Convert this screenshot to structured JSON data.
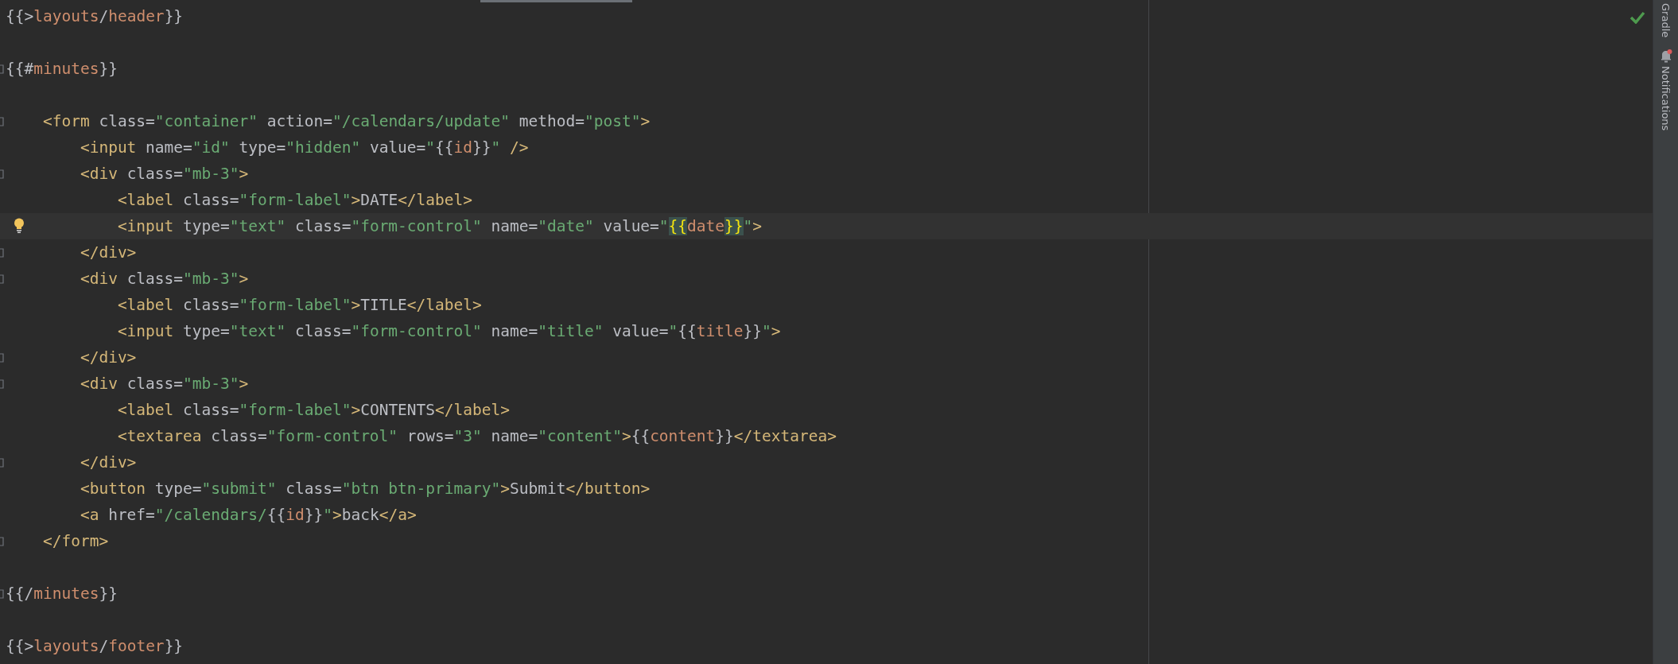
{
  "editor": {
    "lines": [
      {
        "current": false,
        "foldable": false,
        "lightbulb": false,
        "tokens": [
          {
            "kind": "punct",
            "text": "{{>"
          },
          {
            "kind": "var",
            "text": "layouts"
          },
          {
            "kind": "punct",
            "text": "/"
          },
          {
            "kind": "var",
            "text": "header"
          },
          {
            "kind": "punct",
            "text": "}}"
          }
        ]
      },
      {
        "current": false,
        "foldable": false,
        "lightbulb": false
      },
      {
        "current": false,
        "foldable": true,
        "lightbulb": false,
        "tokens": [
          {
            "kind": "punct",
            "text": "{{#"
          },
          {
            "kind": "var",
            "text": "minutes"
          },
          {
            "kind": "punct",
            "text": "}}"
          }
        ]
      },
      {
        "current": false,
        "foldable": false,
        "lightbulb": false
      },
      {
        "current": false,
        "foldable": true,
        "lightbulb": false,
        "tokens": [
          {
            "kind": "tag",
            "text": "    <form "
          },
          {
            "kind": "attr",
            "text": "class="
          },
          {
            "kind": "str",
            "text": "\"container\" "
          },
          {
            "kind": "attr",
            "text": "action="
          },
          {
            "kind": "str",
            "text": "\"/calendars/update\" "
          },
          {
            "kind": "attr",
            "text": "method="
          },
          {
            "kind": "str",
            "text": "\"post\""
          },
          {
            "kind": "tag",
            "text": ">"
          }
        ]
      },
      {
        "current": false,
        "foldable": false,
        "lightbulb": false,
        "tokens": [
          {
            "kind": "tag",
            "text": "        <input "
          },
          {
            "kind": "attr",
            "text": "name="
          },
          {
            "kind": "str",
            "text": "\"id\" "
          },
          {
            "kind": "attr",
            "text": "type="
          },
          {
            "kind": "str",
            "text": "\"hidden\" "
          },
          {
            "kind": "attr",
            "text": "value="
          },
          {
            "kind": "str",
            "text": "\""
          },
          {
            "kind": "punct",
            "text": "{{"
          },
          {
            "kind": "var",
            "text": "id"
          },
          {
            "kind": "punct",
            "text": "}}"
          },
          {
            "kind": "str",
            "text": "\" "
          },
          {
            "kind": "tag",
            "text": "/>"
          }
        ]
      },
      {
        "current": false,
        "foldable": true,
        "lightbulb": false,
        "tokens": [
          {
            "kind": "tag",
            "text": "        <div "
          },
          {
            "kind": "attr",
            "text": "class="
          },
          {
            "kind": "str",
            "text": "\"mb-3\""
          },
          {
            "kind": "tag",
            "text": ">"
          }
        ]
      },
      {
        "current": false,
        "foldable": false,
        "lightbulb": false,
        "tokens": [
          {
            "kind": "tag",
            "text": "            <label "
          },
          {
            "kind": "attr",
            "text": "class="
          },
          {
            "kind": "str",
            "text": "\"form-label\""
          },
          {
            "kind": "tag",
            "text": ">"
          },
          {
            "kind": "text",
            "text": "DATE"
          },
          {
            "kind": "tag",
            "text": "</label>"
          }
        ]
      },
      {
        "current": true,
        "foldable": false,
        "lightbulb": true,
        "tokens": [
          {
            "kind": "tag",
            "text": "            <input "
          },
          {
            "kind": "attr",
            "text": "type="
          },
          {
            "kind": "str",
            "text": "\"text\" "
          },
          {
            "kind": "attr",
            "text": "class="
          },
          {
            "kind": "str",
            "text": "\"form-control\" "
          },
          {
            "kind": "attr",
            "text": "name="
          },
          {
            "kind": "str",
            "text": "\"date\" "
          },
          {
            "kind": "attr",
            "text": "value="
          },
          {
            "kind": "str",
            "text": "\""
          },
          {
            "kind": "match",
            "text": "{{"
          },
          {
            "kind": "var",
            "text": "date"
          },
          {
            "kind": "match",
            "text": "}}"
          },
          {
            "kind": "str",
            "text": "\""
          },
          {
            "kind": "tag",
            "text": ">"
          }
        ]
      },
      {
        "current": false,
        "foldable": true,
        "lightbulb": false,
        "tokens": [
          {
            "kind": "tag",
            "text": "        </div>"
          }
        ]
      },
      {
        "current": false,
        "foldable": true,
        "lightbulb": false,
        "tokens": [
          {
            "kind": "tag",
            "text": "        <div "
          },
          {
            "kind": "attr",
            "text": "class="
          },
          {
            "kind": "str",
            "text": "\"mb-3\""
          },
          {
            "kind": "tag",
            "text": ">"
          }
        ]
      },
      {
        "current": false,
        "foldable": false,
        "lightbulb": false,
        "tokens": [
          {
            "kind": "tag",
            "text": "            <label "
          },
          {
            "kind": "attr",
            "text": "class="
          },
          {
            "kind": "str",
            "text": "\"form-label\""
          },
          {
            "kind": "tag",
            "text": ">"
          },
          {
            "kind": "text",
            "text": "TITLE"
          },
          {
            "kind": "tag",
            "text": "</label>"
          }
        ]
      },
      {
        "current": false,
        "foldable": false,
        "lightbulb": false,
        "tokens": [
          {
            "kind": "tag",
            "text": "            <input "
          },
          {
            "kind": "attr",
            "text": "type="
          },
          {
            "kind": "str",
            "text": "\"text\" "
          },
          {
            "kind": "attr",
            "text": "class="
          },
          {
            "kind": "str",
            "text": "\"form-control\" "
          },
          {
            "kind": "attr",
            "text": "name="
          },
          {
            "kind": "str",
            "text": "\"title\" "
          },
          {
            "kind": "attr",
            "text": "value="
          },
          {
            "kind": "str",
            "text": "\""
          },
          {
            "kind": "punct",
            "text": "{{"
          },
          {
            "kind": "var",
            "text": "title"
          },
          {
            "kind": "punct",
            "text": "}}"
          },
          {
            "kind": "str",
            "text": "\""
          },
          {
            "kind": "tag",
            "text": ">"
          }
        ]
      },
      {
        "current": false,
        "foldable": true,
        "lightbulb": false,
        "tokens": [
          {
            "kind": "tag",
            "text": "        </div>"
          }
        ]
      },
      {
        "current": false,
        "foldable": true,
        "lightbulb": false,
        "tokens": [
          {
            "kind": "tag",
            "text": "        <div "
          },
          {
            "kind": "attr",
            "text": "class="
          },
          {
            "kind": "str",
            "text": "\"mb-3\""
          },
          {
            "kind": "tag",
            "text": ">"
          }
        ]
      },
      {
        "current": false,
        "foldable": false,
        "lightbulb": false,
        "tokens": [
          {
            "kind": "tag",
            "text": "            <label "
          },
          {
            "kind": "attr",
            "text": "class="
          },
          {
            "kind": "str",
            "text": "\"form-label\""
          },
          {
            "kind": "tag",
            "text": ">"
          },
          {
            "kind": "text",
            "text": "CONTENTS"
          },
          {
            "kind": "tag",
            "text": "</label>"
          }
        ]
      },
      {
        "current": false,
        "foldable": false,
        "lightbulb": false,
        "tokens": [
          {
            "kind": "tag",
            "text": "            <textarea "
          },
          {
            "kind": "attr",
            "text": "class="
          },
          {
            "kind": "str",
            "text": "\"form-control\" "
          },
          {
            "kind": "attr",
            "text": "rows="
          },
          {
            "kind": "str",
            "text": "\"3\" "
          },
          {
            "kind": "attr",
            "text": "name="
          },
          {
            "kind": "str",
            "text": "\"content\""
          },
          {
            "kind": "tag",
            "text": ">"
          },
          {
            "kind": "punct",
            "text": "{{"
          },
          {
            "kind": "var",
            "text": "content"
          },
          {
            "kind": "punct",
            "text": "}}"
          },
          {
            "kind": "tag",
            "text": "</textarea>"
          }
        ]
      },
      {
        "current": false,
        "foldable": true,
        "lightbulb": false,
        "tokens": [
          {
            "kind": "tag",
            "text": "        </div>"
          }
        ]
      },
      {
        "current": false,
        "foldable": false,
        "lightbulb": false,
        "tokens": [
          {
            "kind": "tag",
            "text": "        <button "
          },
          {
            "kind": "attr",
            "text": "type="
          },
          {
            "kind": "str",
            "text": "\"submit\" "
          },
          {
            "kind": "attr",
            "text": "class="
          },
          {
            "kind": "str",
            "text": "\"btn btn-primary\""
          },
          {
            "kind": "tag",
            "text": ">"
          },
          {
            "kind": "text",
            "text": "Submit"
          },
          {
            "kind": "tag",
            "text": "</button>"
          }
        ]
      },
      {
        "current": false,
        "foldable": false,
        "lightbulb": false,
        "tokens": [
          {
            "kind": "tag",
            "text": "        <a "
          },
          {
            "kind": "attr",
            "text": "href="
          },
          {
            "kind": "str",
            "text": "\"/calendars/"
          },
          {
            "kind": "punct",
            "text": "{{"
          },
          {
            "kind": "var",
            "text": "id"
          },
          {
            "kind": "punct",
            "text": "}}"
          },
          {
            "kind": "str",
            "text": "\""
          },
          {
            "kind": "tag",
            "text": ">"
          },
          {
            "kind": "text",
            "text": "back"
          },
          {
            "kind": "tag",
            "text": "</a>"
          }
        ]
      },
      {
        "current": false,
        "foldable": true,
        "lightbulb": false,
        "tokens": [
          {
            "kind": "tag",
            "text": "    </form>"
          }
        ]
      },
      {
        "current": false,
        "foldable": false,
        "lightbulb": false
      },
      {
        "current": false,
        "foldable": true,
        "lightbulb": false,
        "tokens": [
          {
            "kind": "punct",
            "text": "{{/"
          },
          {
            "kind": "var",
            "text": "minutes"
          },
          {
            "kind": "punct",
            "text": "}}"
          }
        ]
      },
      {
        "current": false,
        "foldable": false,
        "lightbulb": false
      },
      {
        "current": false,
        "foldable": false,
        "lightbulb": false,
        "tokens": [
          {
            "kind": "punct",
            "text": "{{>"
          },
          {
            "kind": "var",
            "text": "layouts"
          },
          {
            "kind": "punct",
            "text": "/"
          },
          {
            "kind": "var",
            "text": "footer"
          },
          {
            "kind": "punct",
            "text": "}}"
          }
        ]
      }
    ]
  },
  "sidebar": {
    "items": [
      {
        "kind": "plain",
        "label": "Gradle"
      },
      {
        "kind": "bell",
        "label": "Notifications"
      }
    ]
  }
}
